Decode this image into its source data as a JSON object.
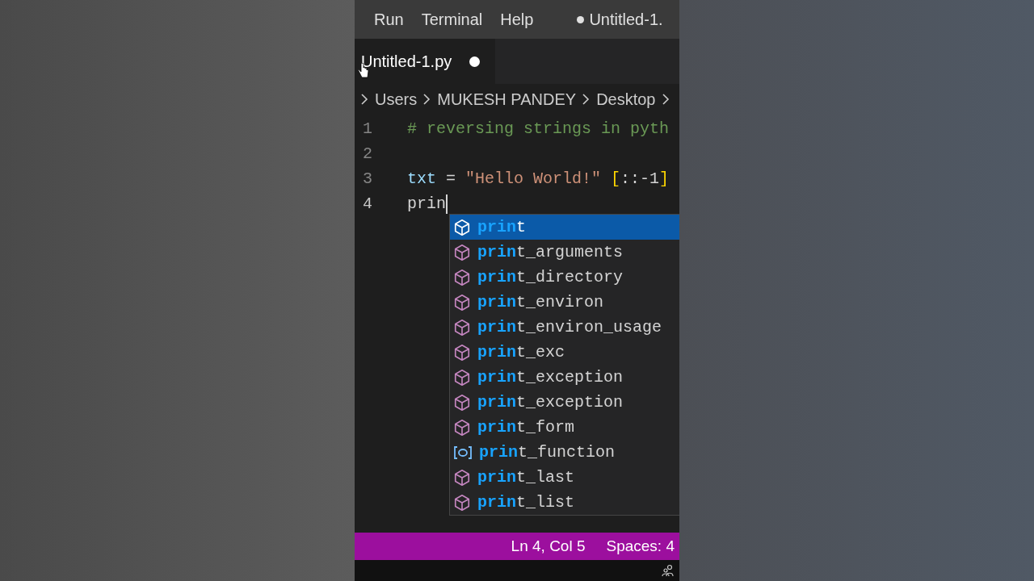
{
  "menu": [
    "Run",
    "Terminal",
    "Help"
  ],
  "window_title": {
    "text": "Untitled-1.",
    "modified": true
  },
  "tab": {
    "label": "Untitled-1.py",
    "modified": true,
    "selected": true
  },
  "breadcrumb": [
    "Users",
    "MUKESH PANDEY",
    "Desktop"
  ],
  "code_lines": [
    {
      "number": "1",
      "tokens": [
        {
          "kind": "comment",
          "text": "# reversing strings in pyth"
        }
      ]
    },
    {
      "number": "2"
    },
    {
      "number": "3",
      "tokens": [
        {
          "kind": "variable",
          "text": "txt"
        },
        {
          "kind": "plain",
          "text": " = "
        },
        {
          "kind": "string",
          "text": "\"Hello World!\""
        },
        {
          "kind": "bracket",
          "text": "["
        },
        {
          "kind": "plain",
          "text": "::-1"
        },
        {
          "kind": "bracket",
          "text": "]"
        }
      ]
    },
    {
      "number": "4",
      "tokens": [
        {
          "kind": "plain",
          "text": "prin"
        }
      ],
      "cursor": true
    }
  ],
  "suggestions": [
    {
      "label": "**prin**t",
      "kind": "module",
      "selected": true
    },
    {
      "label": "**prin**t_arguments",
      "kind": "module",
      "selected": false
    },
    {
      "label": "**prin**t_directory",
      "kind": "module",
      "selected": false
    },
    {
      "label": "**prin**t_environ",
      "kind": "module",
      "selected": false
    },
    {
      "label": "**prin**t_environ_usage",
      "kind": "module",
      "selected": false
    },
    {
      "label": "**prin**t_exc",
      "kind": "module",
      "selected": false
    },
    {
      "label": "**prin**t_exception",
      "kind": "module",
      "selected": false
    },
    {
      "label": "**prin**t_exception",
      "kind": "module",
      "selected": false
    },
    {
      "label": "**prin**t_form",
      "kind": "module",
      "selected": false
    },
    {
      "label": "**prin**t_function",
      "kind": "variable",
      "selected": false
    },
    {
      "label": "**prin**t_last",
      "kind": "module",
      "selected": false
    },
    {
      "label": "**prin**t_list",
      "kind": "module",
      "selected": false
    }
  ],
  "status_bar": [
    "Ln 4, Col 5",
    "Spaces: 4"
  ]
}
